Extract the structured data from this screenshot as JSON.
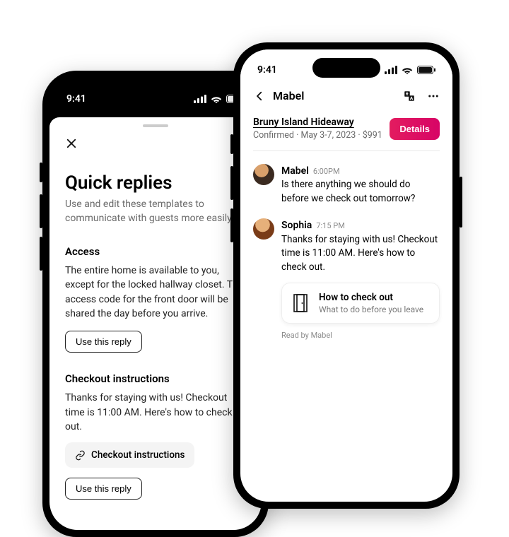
{
  "status_time": "9:41",
  "quick_replies": {
    "title": "Quick replies",
    "subtitle": "Use and edit these templates to communicate with guests more easily.",
    "sections": [
      {
        "heading": "Access",
        "body": "The entire home is available to you, except for the locked hallway closet. The access code for the front door will be shared the day before you arrive.",
        "button": "Use this reply"
      },
      {
        "heading": "Checkout instructions",
        "body": "Thanks for staying with us! Checkout time is 11:00 AM.  Here's how to check out.",
        "chip": "Checkout instructions",
        "button": "Use this reply"
      }
    ]
  },
  "thread": {
    "contact_name": "Mabel",
    "listing_title": "Bruny Island Hideaway",
    "listing_sub": "Confirmed · May 3-7, 2023 · $991",
    "details_button": "Details",
    "messages": [
      {
        "name": "Mabel",
        "time": "6:00PM",
        "text": "Is there anything we should do before we check out tomorrow?"
      },
      {
        "name": "Sophia",
        "time": "7:15 PM",
        "text": "Thanks for staying with us! Checkout time is 11:00 AM. Here's how to check out."
      }
    ],
    "attachment": {
      "title": "How to check out",
      "subtitle": "What to do before you leave"
    },
    "read_receipt": "Read by Mabel"
  }
}
